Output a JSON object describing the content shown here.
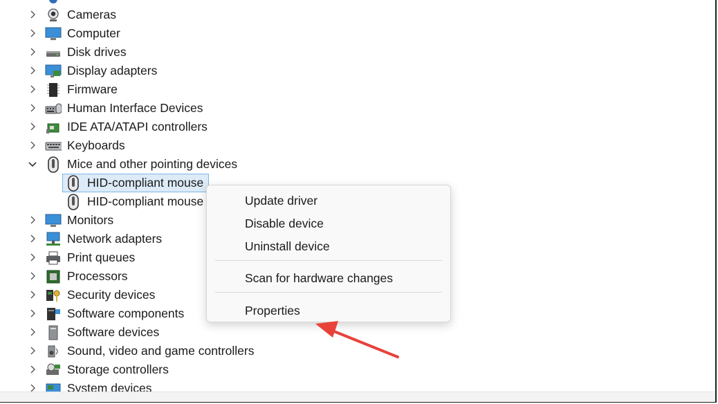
{
  "tree": {
    "categories": [
      {
        "label": "Cameras",
        "icon": "camera-icon",
        "expanded": false
      },
      {
        "label": "Computer",
        "icon": "computer-icon",
        "expanded": false
      },
      {
        "label": "Disk drives",
        "icon": "disk-drive-icon",
        "expanded": false
      },
      {
        "label": "Display adapters",
        "icon": "display-adapter-icon",
        "expanded": false
      },
      {
        "label": "Firmware",
        "icon": "firmware-icon",
        "expanded": false
      },
      {
        "label": "Human Interface Devices",
        "icon": "hid-icon",
        "expanded": false
      },
      {
        "label": "IDE ATA/ATAPI controllers",
        "icon": "ide-controller-icon",
        "expanded": false
      },
      {
        "label": "Keyboards",
        "icon": "keyboard-icon",
        "expanded": false
      },
      {
        "label": "Mice and other pointing devices",
        "icon": "mouse-icon",
        "expanded": true,
        "children": [
          {
            "label": "HID-compliant mouse",
            "icon": "mouse-icon",
            "selected": true
          },
          {
            "label": "HID-compliant mouse",
            "icon": "mouse-icon",
            "selected": false
          }
        ]
      },
      {
        "label": "Monitors",
        "icon": "monitor-icon",
        "expanded": false
      },
      {
        "label": "Network adapters",
        "icon": "network-adapter-icon",
        "expanded": false
      },
      {
        "label": "Print queues",
        "icon": "printer-icon",
        "expanded": false
      },
      {
        "label": "Processors",
        "icon": "processor-icon",
        "expanded": false
      },
      {
        "label": "Security devices",
        "icon": "security-device-icon",
        "expanded": false
      },
      {
        "label": "Software components",
        "icon": "software-component-icon",
        "expanded": false
      },
      {
        "label": "Software devices",
        "icon": "software-device-icon",
        "expanded": false
      },
      {
        "label": "Sound, video and game controllers",
        "icon": "speaker-icon",
        "expanded": false
      },
      {
        "label": "Storage controllers",
        "icon": "storage-controller-icon",
        "expanded": false
      },
      {
        "label": "System devices",
        "icon": "system-device-icon",
        "expanded": false
      }
    ]
  },
  "context_menu": {
    "update_driver": "Update driver",
    "disable_device": "Disable device",
    "uninstall_device": "Uninstall device",
    "scan_hardware": "Scan for hardware changes",
    "properties": "Properties"
  },
  "colors": {
    "selection_bg": "#dcebf7",
    "selection_border": "#7fb6e3",
    "annotation_arrow": "#e8423b"
  }
}
